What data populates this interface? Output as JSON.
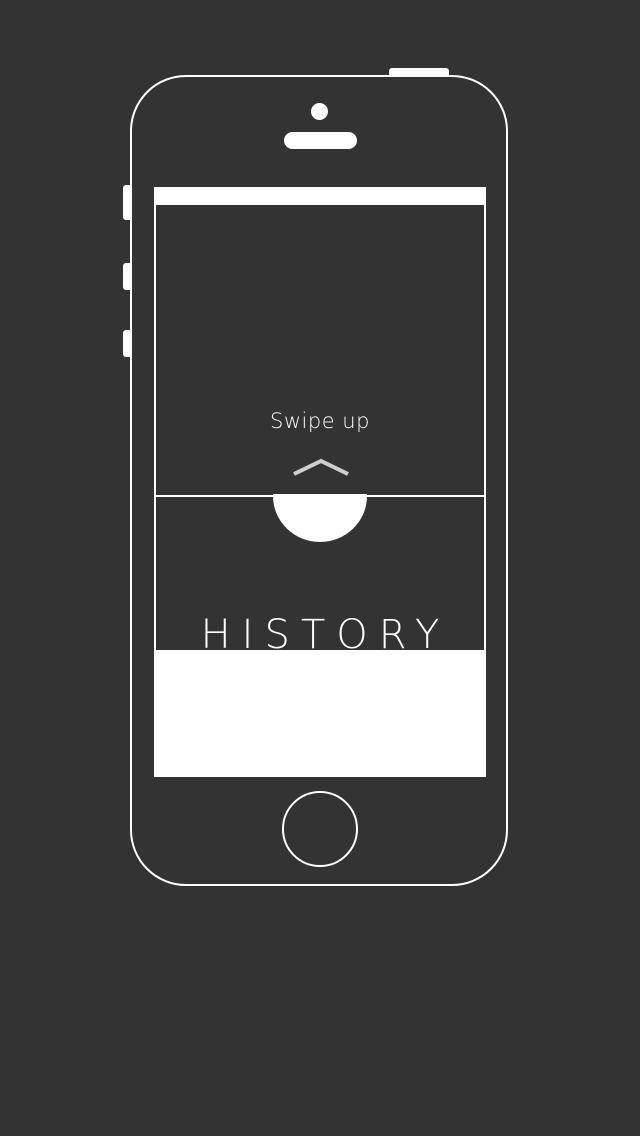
{
  "onboarding": {
    "swipe_hint": "Swipe up",
    "section_title": "HISTORY"
  },
  "icons": {
    "chevron": "chevron-up-icon"
  },
  "colors": {
    "background": "#333333",
    "outline": "#ffffff",
    "chevron": "#cfcfcf"
  }
}
